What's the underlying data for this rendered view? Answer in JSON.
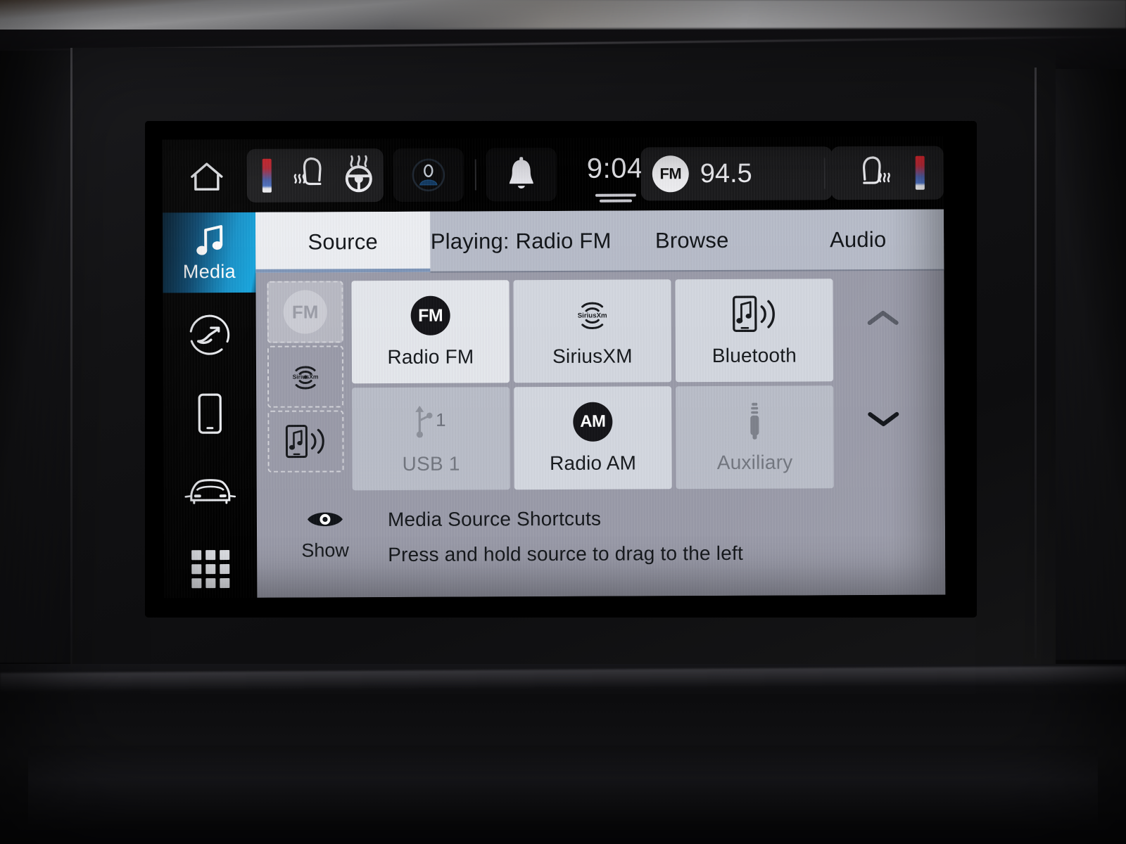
{
  "device": {
    "kind": "car-infotainment-touchscreen"
  },
  "status_bar": {
    "home_icon": "home-icon",
    "climate_pod": {
      "temp_bar": "temperature-gauge-icon",
      "seat_heat_icon": "heated-seat-icon",
      "steering_heat_icon": "heated-steering-wheel-icon"
    },
    "profile_icon": "driver-profile-icon",
    "notifications_icon": "bell-icon",
    "clock": "9:04",
    "pull_handle": "pull-down-handle",
    "radio": {
      "band_badge": "FM",
      "frequency": "94.5"
    },
    "passenger_pod": {
      "seat_heat_icon": "heated-seat-icon",
      "temp_bar": "temperature-gauge-icon"
    }
  },
  "sidebar": {
    "items": [
      {
        "label": "Media",
        "icon": "music-note-icon",
        "active": true
      },
      {
        "label": "",
        "icon": "climate-comfort-icon",
        "active": false
      },
      {
        "label": "",
        "icon": "phone-icon",
        "active": false
      },
      {
        "label": "",
        "icon": "vehicle-icon",
        "active": false
      },
      {
        "label": "",
        "icon": "apps-grid-icon",
        "active": false
      }
    ]
  },
  "tabs": [
    {
      "label": "Source",
      "active": true
    },
    {
      "label": "Playing: Radio FM",
      "active": false
    },
    {
      "label": "Browse",
      "active": false
    },
    {
      "label": "Audio",
      "active": false
    }
  ],
  "shortcut_rail": {
    "slots": [
      {
        "icon": "fm-badge-icon",
        "state": "dragging"
      },
      {
        "icon": "siriusxm-icon",
        "state": "filled"
      },
      {
        "icon": "bluetooth-audio-icon",
        "state": "filled"
      }
    ]
  },
  "sources": [
    {
      "label": "Radio FM",
      "icon": "fm-badge-icon",
      "state": "selected"
    },
    {
      "label": "SiriusXM",
      "icon": "siriusxm-icon",
      "state": "available"
    },
    {
      "label": "Bluetooth",
      "icon": "bluetooth-audio-icon",
      "state": "available"
    },
    {
      "label": "USB 1",
      "icon": "usb-icon",
      "state": "disabled"
    },
    {
      "label": "Radio AM",
      "icon": "am-badge-icon",
      "state": "available"
    },
    {
      "label": "Auxiliary",
      "icon": "aux-jack-icon",
      "state": "disabled"
    }
  ],
  "scroll": {
    "up_icon": "chevron-up-icon",
    "up_enabled": false,
    "down_icon": "chevron-down-icon",
    "down_enabled": true
  },
  "footer": {
    "eye_icon": "eye-icon",
    "show_label": "Show",
    "title": "Media Source Shortcuts",
    "hint": "Press and hold source to drag to the left"
  },
  "colors": {
    "panel_bg": "#9a9ba9",
    "tabbar_bg": "#b7bcc9",
    "active_tab_bg": "#eceef2",
    "tile_bg": "#c6cad4",
    "tile_selected_bg": "#e4e7ec",
    "sidebar_active_cyan": "#13a4dd",
    "status_bar_bg": "#000000",
    "badge_black": "#111111"
  }
}
